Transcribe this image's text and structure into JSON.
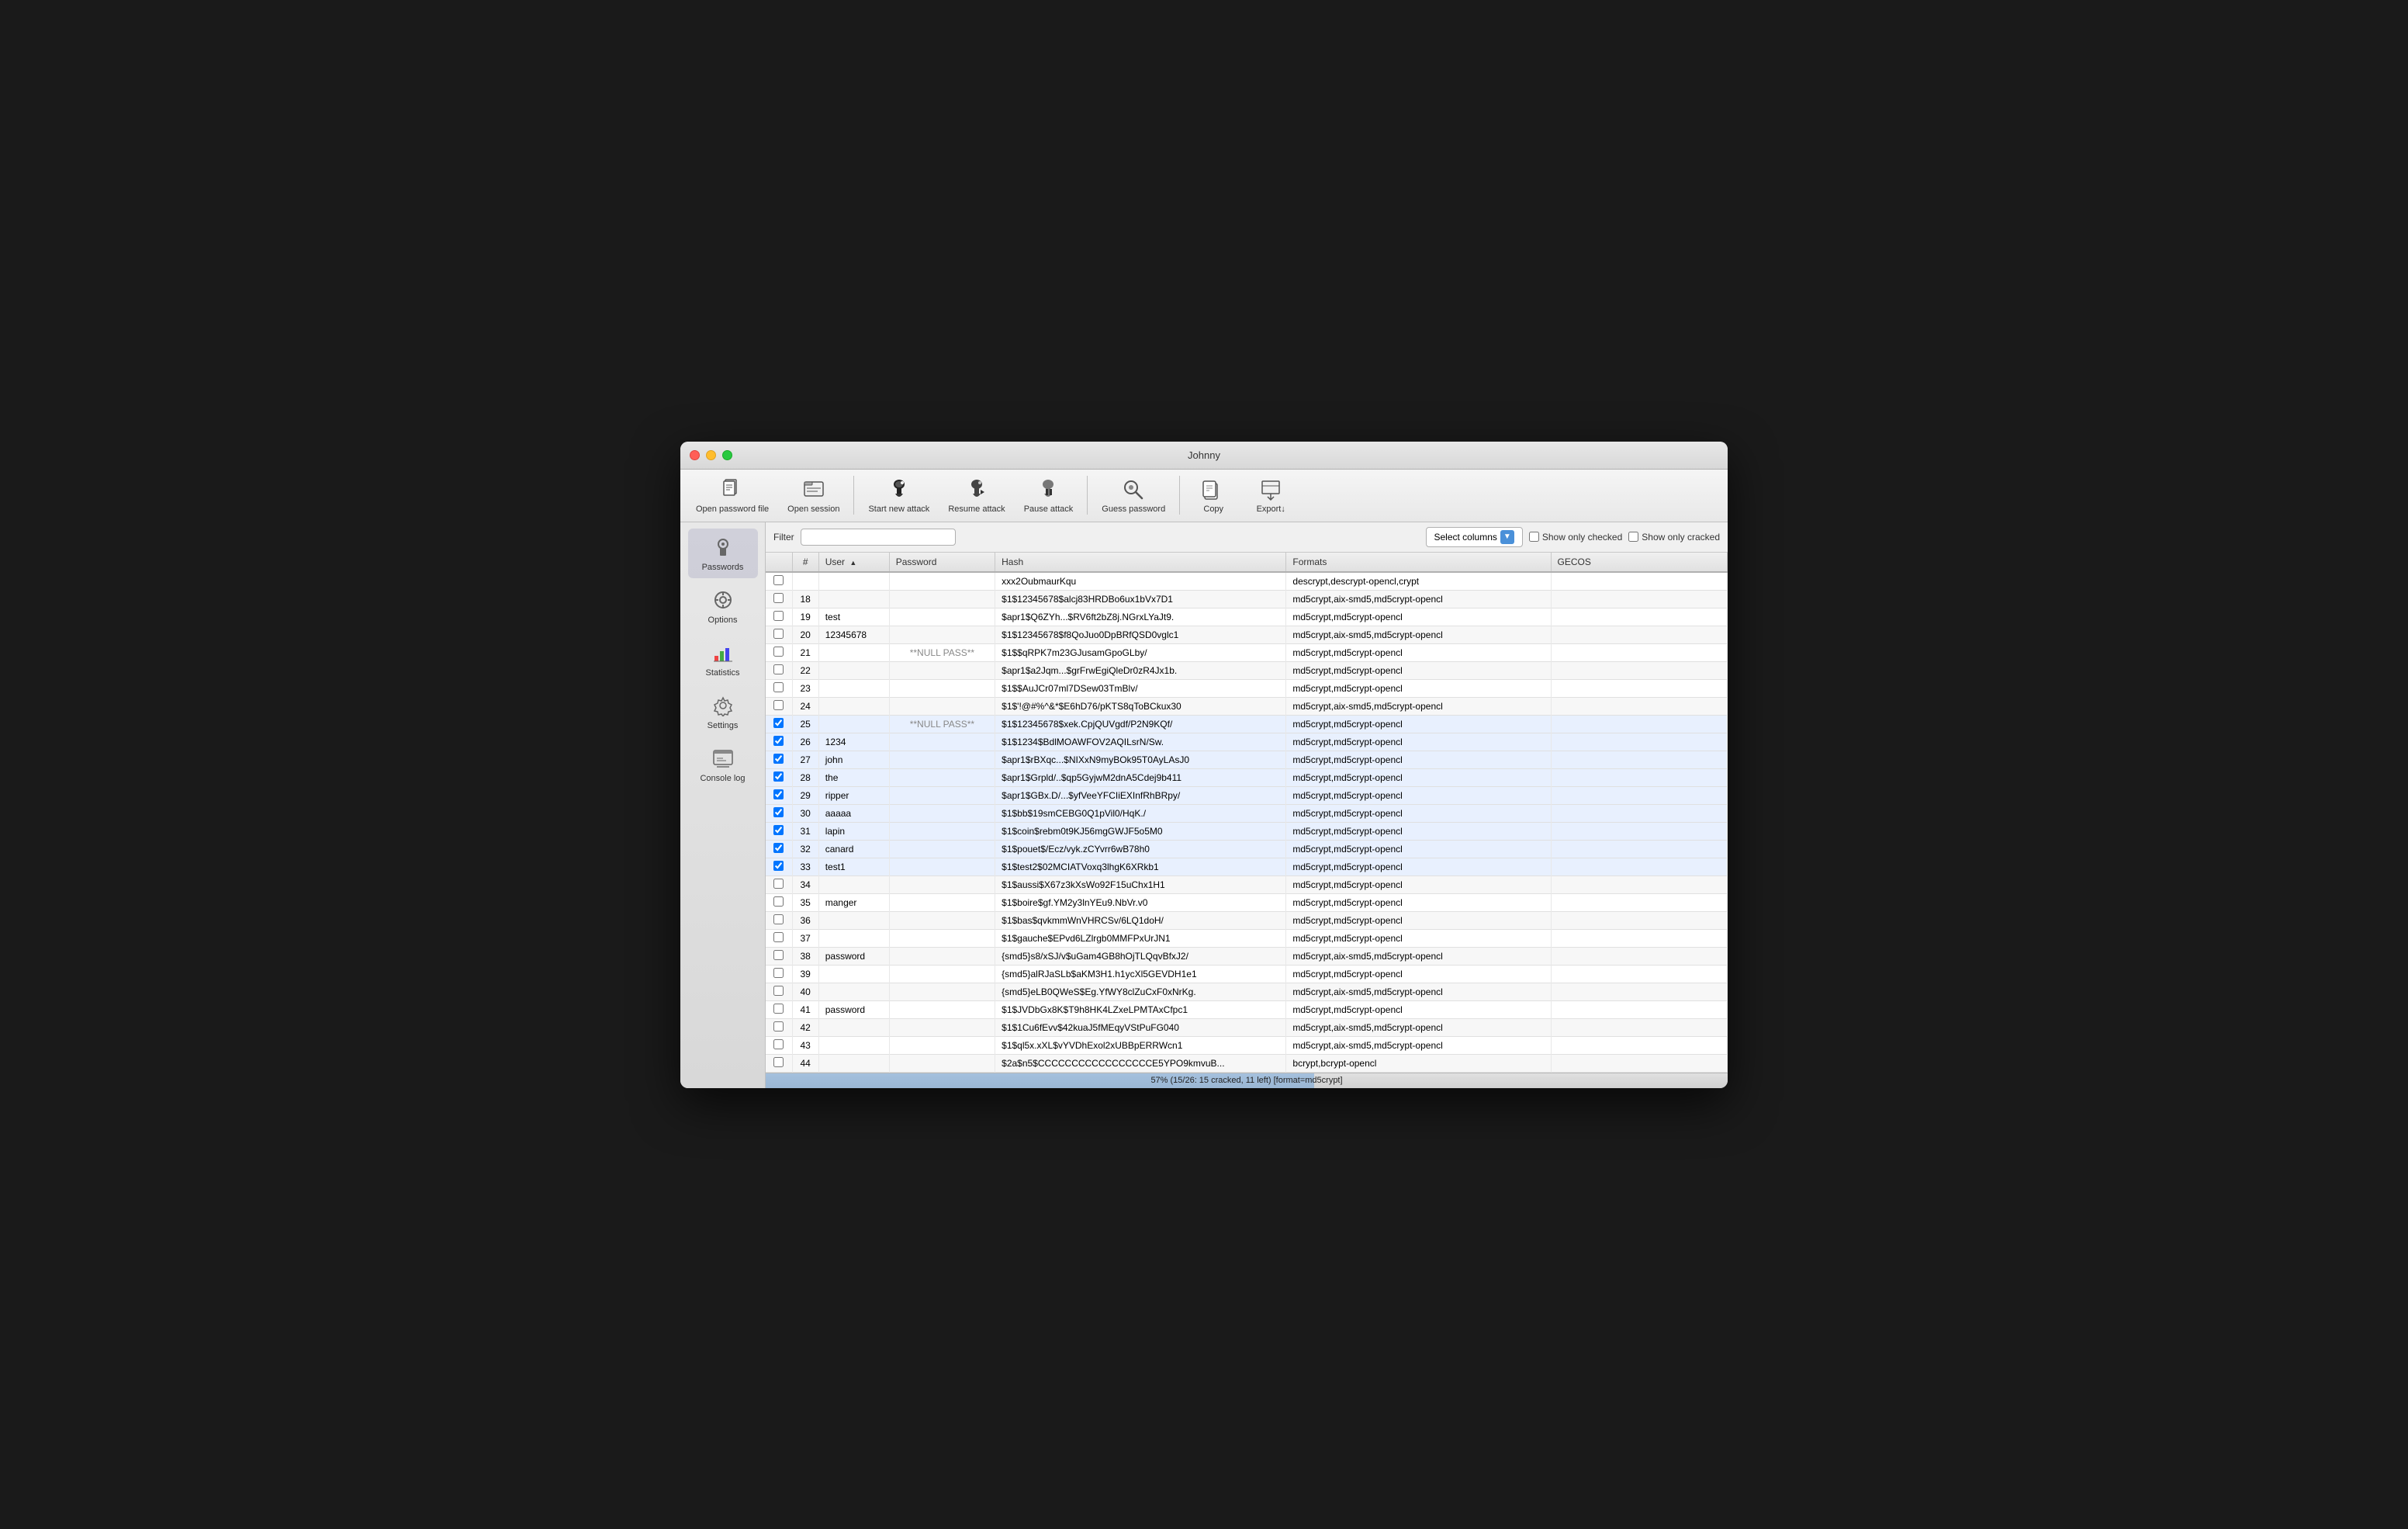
{
  "window": {
    "title": "Johnny"
  },
  "toolbar": {
    "buttons": [
      {
        "id": "open-password-file",
        "label": "Open password file",
        "icon": "📄"
      },
      {
        "id": "open-session",
        "label": "Open session",
        "icon": "📂"
      },
      {
        "id": "start-new-attack",
        "label": "Start new attack",
        "icon": "🎩"
      },
      {
        "id": "resume-attack",
        "label": "Resume attack",
        "icon": "▶"
      },
      {
        "id": "pause-attack",
        "label": "Pause attack",
        "icon": "⏸"
      },
      {
        "id": "guess-password",
        "label": "Guess password",
        "icon": "🔮"
      },
      {
        "id": "copy",
        "label": "Copy",
        "icon": "💾"
      },
      {
        "id": "export",
        "label": "Export↓",
        "icon": "📤"
      }
    ]
  },
  "sidebar": {
    "items": [
      {
        "id": "passwords",
        "label": "Passwords",
        "icon": "🔑",
        "active": true
      },
      {
        "id": "options",
        "label": "Options",
        "icon": "⚙"
      },
      {
        "id": "statistics",
        "label": "Statistics",
        "icon": "📊"
      },
      {
        "id": "settings",
        "label": "Settings",
        "icon": "🔧"
      },
      {
        "id": "console-log",
        "label": "Console log",
        "icon": "🖥"
      }
    ]
  },
  "filter": {
    "label": "Filter",
    "placeholder": "",
    "value": ""
  },
  "columns_btn": {
    "label": "Select columns"
  },
  "checkboxes": {
    "show_checked": "Show only checked",
    "show_cracked": "Show only cracked"
  },
  "table": {
    "headers": [
      "",
      "#",
      "User",
      "Password",
      "Hash",
      "Formats",
      "GECOS"
    ],
    "rows": [
      {
        "row_num": "",
        "num": "",
        "user": "",
        "password": "",
        "hash": "xxx2OubmaurKqu",
        "formats": "descrypt,descrypt-opencl,crypt",
        "gecos": ""
      },
      {
        "row_num": "18",
        "num": "18",
        "user": "",
        "password": "",
        "hash": "$1$12345678$alcj83HRDBo6ux1bVx7D1",
        "formats": "md5crypt,aix-smd5,md5crypt-opencl",
        "gecos": ""
      },
      {
        "row_num": "19",
        "num": "19",
        "user": "test",
        "password": "",
        "hash": "$apr1$Q6ZYh...$RV6ft2bZ8j.NGrxLYaJt9.",
        "formats": "md5crypt,md5crypt-opencl",
        "gecos": ""
      },
      {
        "row_num": "20",
        "num": "20",
        "user": "12345678",
        "password": "",
        "hash": "$1$12345678$f8QoJuo0DpBRfQSD0vglc1",
        "formats": "md5crypt,aix-smd5,md5crypt-opencl",
        "gecos": ""
      },
      {
        "row_num": "21",
        "num": "21",
        "user": "",
        "password": "**NULL PASS**",
        "hash": "$1$$qRPK7m23GJusamGpoGLby/",
        "formats": "md5crypt,md5crypt-opencl",
        "gecos": ""
      },
      {
        "row_num": "22",
        "num": "22",
        "user": "",
        "password": "",
        "hash": "$apr1$a2Jqm...$grFrwEgiQleDr0zR4Jx1b.",
        "formats": "md5crypt,md5crypt-opencl",
        "gecos": ""
      },
      {
        "row_num": "23",
        "num": "23",
        "user": "",
        "password": "",
        "hash": "$1$$AuJCr07ml7DSew03TmBlv/",
        "formats": "md5crypt,md5crypt-opencl",
        "gecos": ""
      },
      {
        "row_num": "24",
        "num": "24",
        "user": "",
        "password": "",
        "hash": "$1$'!@#%^&*$E6hD76/pKTS8qToBCkux30",
        "formats": "md5crypt,aix-smd5,md5crypt-opencl",
        "gecos": ""
      },
      {
        "row_num": "25",
        "num": "25",
        "user": "",
        "password": "**NULL PASS**",
        "hash": "$1$12345678$xek.CpjQUVgdf/P2N9KQf/",
        "formats": "md5crypt,md5crypt-opencl",
        "gecos": "",
        "checked": true
      },
      {
        "row_num": "26",
        "num": "26",
        "user": "1234",
        "password": "",
        "hash": "$1$1234$BdlMOAWFOV2AQILsrN/Sw.",
        "formats": "md5crypt,md5crypt-opencl",
        "gecos": "",
        "checked": true
      },
      {
        "row_num": "27",
        "num": "27",
        "user": "john",
        "password": "",
        "hash": "$apr1$rBXqc...$NIXxN9myBOk95T0AyLAsJ0",
        "formats": "md5crypt,md5crypt-opencl",
        "gecos": "",
        "checked": true
      },
      {
        "row_num": "28",
        "num": "28",
        "user": "the",
        "password": "",
        "hash": "$apr1$Grpld/..$qp5GyjwM2dnA5Cdej9b411",
        "formats": "md5crypt,md5crypt-opencl",
        "gecos": "",
        "checked": true
      },
      {
        "row_num": "29",
        "num": "29",
        "user": "ripper",
        "password": "",
        "hash": "$apr1$GBx.D/...$yfVeeYFCIiEXInfRhBRpy/",
        "formats": "md5crypt,md5crypt-opencl",
        "gecos": "",
        "checked": true
      },
      {
        "row_num": "30",
        "num": "30",
        "user": "aaaaa",
        "password": "",
        "hash": "$1$bb$19smCEBG0Q1pVil0/HqK./",
        "formats": "md5crypt,md5crypt-opencl",
        "gecos": "",
        "checked": true
      },
      {
        "row_num": "31",
        "num": "31",
        "user": "lapin",
        "password": "",
        "hash": "$1$coin$rebm0t9KJ56mgGWJF5o5M0",
        "formats": "md5crypt,md5crypt-opencl",
        "gecos": "",
        "checked": true
      },
      {
        "row_num": "32",
        "num": "32",
        "user": "canard",
        "password": "",
        "hash": "$1$pouet$/Ecz/vyk.zCYvrr6wB78h0",
        "formats": "md5crypt,md5crypt-opencl",
        "gecos": "",
        "checked": true
      },
      {
        "row_num": "33",
        "num": "33",
        "user": "test1",
        "password": "",
        "hash": "$1$test2$02MCIATVoxq3lhgK6XRkb1",
        "formats": "md5crypt,md5crypt-opencl",
        "gecos": "",
        "checked": true
      },
      {
        "row_num": "34",
        "num": "34",
        "user": "",
        "password": "",
        "hash": "$1$aussi$X67z3kXsWo92F15uChx1H1",
        "formats": "md5crypt,md5crypt-opencl",
        "gecos": ""
      },
      {
        "row_num": "35",
        "num": "35",
        "user": "manger",
        "password": "",
        "hash": "$1$boire$gf.YM2y3lnYEu9.NbVr.v0",
        "formats": "md5crypt,md5crypt-opencl",
        "gecos": ""
      },
      {
        "row_num": "36",
        "num": "36",
        "user": "",
        "password": "",
        "hash": "$1$bas$qvkmmWnVHRCSv/6LQ1doH/",
        "formats": "md5crypt,md5crypt-opencl",
        "gecos": ""
      },
      {
        "row_num": "37",
        "num": "37",
        "user": "",
        "password": "",
        "hash": "$1$gauche$EPvd6LZlrgb0MMFPxUrJN1",
        "formats": "md5crypt,md5crypt-opencl",
        "gecos": ""
      },
      {
        "row_num": "38",
        "num": "38",
        "user": "password",
        "password": "",
        "hash": "{smd5}s8/xSJ/v$uGam4GB8hOjTLQqvBfxJ2/",
        "formats": "md5crypt,aix-smd5,md5crypt-opencl",
        "gecos": ""
      },
      {
        "row_num": "39",
        "num": "39",
        "user": "",
        "password": "",
        "hash": "{smd5}alRJaSLb$aKM3H1.h1ycXl5GEVDH1e1",
        "formats": "md5crypt,md5crypt-opencl",
        "gecos": ""
      },
      {
        "row_num": "40",
        "num": "40",
        "user": "",
        "password": "",
        "hash": "{smd5}eLB0QWeS$Eg.YfWY8clZuCxF0xNrKg.",
        "formats": "md5crypt,aix-smd5,md5crypt-opencl",
        "gecos": ""
      },
      {
        "row_num": "41",
        "num": "41",
        "user": "password",
        "password": "",
        "hash": "$1$JVDbGx8K$T9h8HK4LZxeLPMTAxCfpc1",
        "formats": "md5crypt,md5crypt-opencl",
        "gecos": ""
      },
      {
        "row_num": "42",
        "num": "42",
        "user": "",
        "password": "",
        "hash": "$1$1Cu6fEvv$42kuaJ5fMEqyVStPuFG040",
        "formats": "md5crypt,aix-smd5,md5crypt-opencl",
        "gecos": ""
      },
      {
        "row_num": "43",
        "num": "43",
        "user": "",
        "password": "",
        "hash": "$1$ql5x.xXL$vYVDhExol2xUBBpERRWcn1",
        "formats": "md5crypt,aix-smd5,md5crypt-opencl",
        "gecos": ""
      },
      {
        "row_num": "44",
        "num": "44",
        "user": "",
        "password": "",
        "hash": "$2a$n5$CCCCCCCCCCCCCCCCCE5YPO9kmvuB...",
        "formats": "bcrypt,bcrypt-opencl",
        "gecos": ""
      }
    ]
  },
  "status": {
    "text": "57% (15/26: 15 cracked, 11 left) [format=md5crypt]",
    "progress_percent": 57
  }
}
